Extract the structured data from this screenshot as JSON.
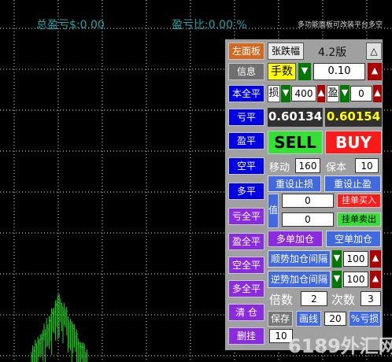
{
  "header": {
    "total_pnl": "总盈亏$:0.00",
    "pnl_ratio": "盈亏比:0.00 %",
    "right_text": "多功能面板可改装平台多空"
  },
  "panel": {
    "left_panel_label": "左面板",
    "price_tab": "张跌幅",
    "version": "4.2版",
    "collapse_glyph": "△",
    "info_label": "信息",
    "lots_label": "手数",
    "lots_value": "0.10",
    "close_all_label": "本全平",
    "sl_label": "损",
    "sl_value": "400",
    "tp_label": "盈",
    "tp_value": "0",
    "loss_close_label": "亏平",
    "bid": "0.60134",
    "ask": "0.60154",
    "profit_close_label": "盈平",
    "sell_label": "SELL",
    "buy_label": "BUY",
    "short_close_label": "空平",
    "trailing_label": "移动",
    "trailing_value": "160",
    "breakeven_label": "保本",
    "breakeven_value": "10",
    "long_close_label": "多平",
    "reset_sl_label": "重设止损",
    "reset_tp_label": "重设止盈",
    "value_label": "值",
    "pending_value_1": "0",
    "pending_value_2": "0",
    "pending_buy_label": "挂单买入",
    "pending_sell_label": "挂单卖出",
    "loss_all_close_label": "亏全平",
    "long_add_label": "多单加仓",
    "short_add_label": "空单加仓",
    "profit_all_close_label": "盈全平",
    "trend_interval_label": "顺势加仓间隔",
    "trend_interval_value": "100",
    "short_all_close_label": "空全平",
    "counter_interval_label": "逆势加仓间隔",
    "counter_interval_value": "100",
    "long_all_close_label": "多全平",
    "multiplier_label": "倍数",
    "multiplier_value": "2",
    "count_label": "次数",
    "count_value": "3",
    "clear_label": "清 仓",
    "save_label": "保存",
    "draw_label": "画线",
    "percent_value": "20",
    "percent_loss_label": "%亏损",
    "delete_pending_label": "删挂",
    "bottom_value": "10"
  },
  "chart_data": {
    "type": "bar",
    "grid": true,
    "colors": {
      "grid": "#e0e0e0",
      "bars": "#22cc22",
      "background": "#000000"
    }
  },
  "watermark": "6189外汇网"
}
